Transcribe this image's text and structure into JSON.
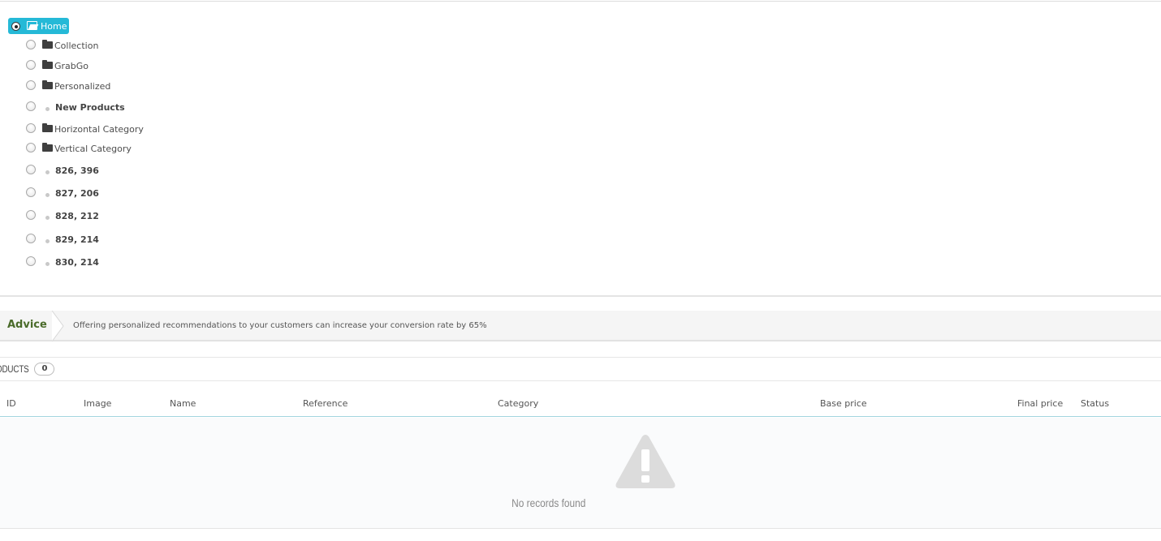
{
  "tree": {
    "root": {
      "label": "Home",
      "selected": true
    },
    "children": [
      {
        "label": "Collection",
        "icon": "folder-icon",
        "bold": false
      },
      {
        "label": "GrabGo",
        "icon": "folder-icon",
        "bold": false
      },
      {
        "label": "Personalized",
        "icon": "folder-icon",
        "bold": false
      },
      {
        "label": "New Products",
        "icon": "bullet-icon",
        "bold": true
      },
      {
        "label": "Horizontal Category",
        "icon": "folder-icon",
        "bold": false
      },
      {
        "label": "Vertical Category",
        "icon": "folder-icon",
        "bold": false
      },
      {
        "label": "826, 396",
        "icon": "bullet-icon",
        "bold": true
      },
      {
        "label": "827, 206",
        "icon": "bullet-icon",
        "bold": true
      },
      {
        "label": "828, 212",
        "icon": "bullet-icon",
        "bold": true
      },
      {
        "label": "829, 214",
        "icon": "bullet-icon",
        "bold": true
      },
      {
        "label": "830, 214",
        "icon": "bullet-icon",
        "bold": true
      }
    ]
  },
  "advice": {
    "title": "Advice",
    "text": "Offering personalized recommendations to your customers can increase your conversion rate by 65%"
  },
  "products": {
    "heading": "ODUCTS",
    "count": "0",
    "columns": [
      "ID",
      "Image",
      "Name",
      "Reference",
      "Category",
      "Base price",
      "Final price",
      "Status"
    ],
    "empty_icon": "warning-icon",
    "empty_text": "No records found"
  },
  "colors": {
    "accent": "#25b9d7",
    "advice_title": "#4a6b2a",
    "table_rule": "#a3d5df"
  }
}
